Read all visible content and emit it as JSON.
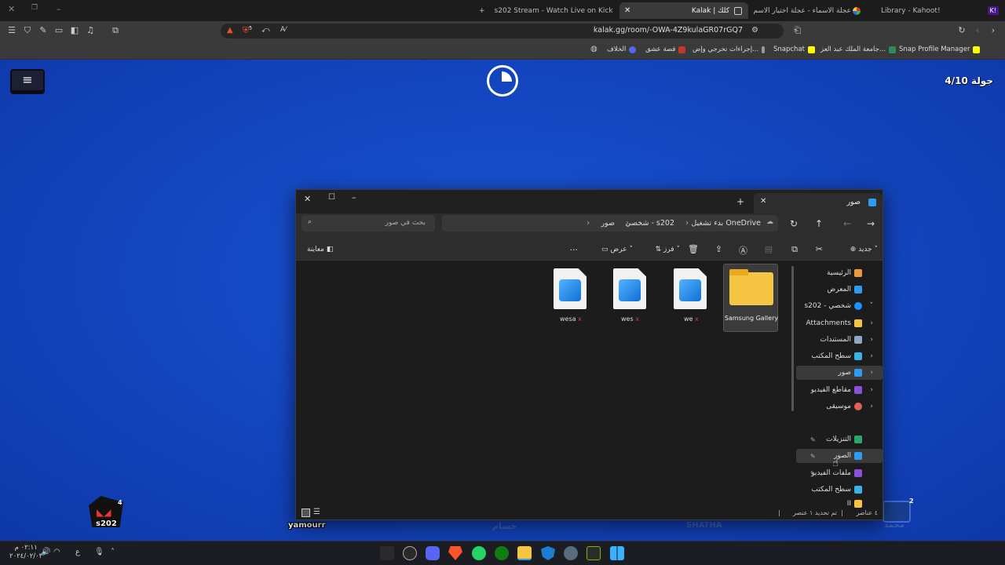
{
  "browser": {
    "tabs": [
      {
        "label": "Library - Kahoot!",
        "active": false
      },
      {
        "label": "عجلة الأسماء - عجلة اختيار الاسم العشوائي | Wheel of Names",
        "active": false
      },
      {
        "label": "Kalak | كلك",
        "active": true
      },
      {
        "label": "s202 Stream - Watch Live on Kick",
        "active": false
      }
    ],
    "url": "kalak.gg/room/-OWA-4Z9kulaGR07rGQ7",
    "bookmarks": [
      {
        "label": "Snap Profile Manager"
      },
      {
        "label": "جامعة الملك عبد العز..."
      },
      {
        "label": "Snapchat"
      },
      {
        "label": "إجراءات تخرجي وإض..."
      },
      {
        "label": "قصة عشق"
      },
      {
        "label": "الخلاف"
      }
    ],
    "shield_count": "5"
  },
  "game": {
    "round_label": "جولة 4/10",
    "players": [
      {
        "name": "s202",
        "badge": "4"
      },
      {
        "name": "yamourr"
      },
      {
        "name": "حسام"
      },
      {
        "name": "SHATHA"
      },
      {
        "name": "محمد",
        "badge": "2"
      }
    ]
  },
  "explorer": {
    "tab_title": "صور",
    "add_tab": "+",
    "search_placeholder": "بحث في صور",
    "breadcrumbs": [
      "بدء تشغيل OneDrive",
      "شخصي - s202",
      "صور"
    ],
    "commands": {
      "new": "جديد",
      "sort": "فرز",
      "view": "عرض",
      "more": "...",
      "preview": "معاينة"
    },
    "files": [
      {
        "name": "Samsung Gallery",
        "type": "folder"
      },
      {
        "name": "we",
        "type": "image",
        "error_icon": "x"
      },
      {
        "name": "wes",
        "type": "image",
        "error_icon": "x"
      },
      {
        "name": "wesa",
        "type": "image",
        "error_icon": "x"
      }
    ],
    "sidebar": [
      {
        "label": "الرئيسية",
        "icon": "home-icon"
      },
      {
        "label": "المعرض",
        "icon": "gallery-icon"
      },
      {
        "label": "s202 - شخصي",
        "icon": "onedrive-icon",
        "expanded": true
      },
      {
        "label": "Attachments",
        "icon": "folder-icon"
      },
      {
        "label": "المستندات",
        "icon": "documents-icon"
      },
      {
        "label": "سطح المكتب",
        "icon": "desktop-icon"
      },
      {
        "label": "صور",
        "icon": "pictures-icon",
        "selected": true
      },
      {
        "label": "مقاطع الفيديو",
        "icon": "videos-icon"
      },
      {
        "label": "موسيقى",
        "icon": "music-icon"
      },
      {
        "label": "التنزيلات",
        "icon": "downloads-icon",
        "pinned": true
      },
      {
        "label": "الصور",
        "icon": "pictures-icon",
        "pinned": true,
        "hover": true
      },
      {
        "label": "ملفات الفيديو",
        "icon": "videos-icon",
        "pinned": true
      },
      {
        "label": "سطح المكتب",
        "icon": "desktop-icon"
      },
      {
        "label": "II",
        "icon": "folder-icon"
      }
    ],
    "status": {
      "count": "٤ عناصر",
      "selection": "تم تحديد ١ عنصر"
    }
  },
  "taskbar": {
    "time": "٠٢:١١ م",
    "date": "٢٠٢٤/٠٢/٠٣",
    "lang": "ع"
  },
  "colors": {
    "game_blue": "#1447c2",
    "explorer_bg": "#1c1c1c",
    "accent_folder": "#f5c443"
  }
}
